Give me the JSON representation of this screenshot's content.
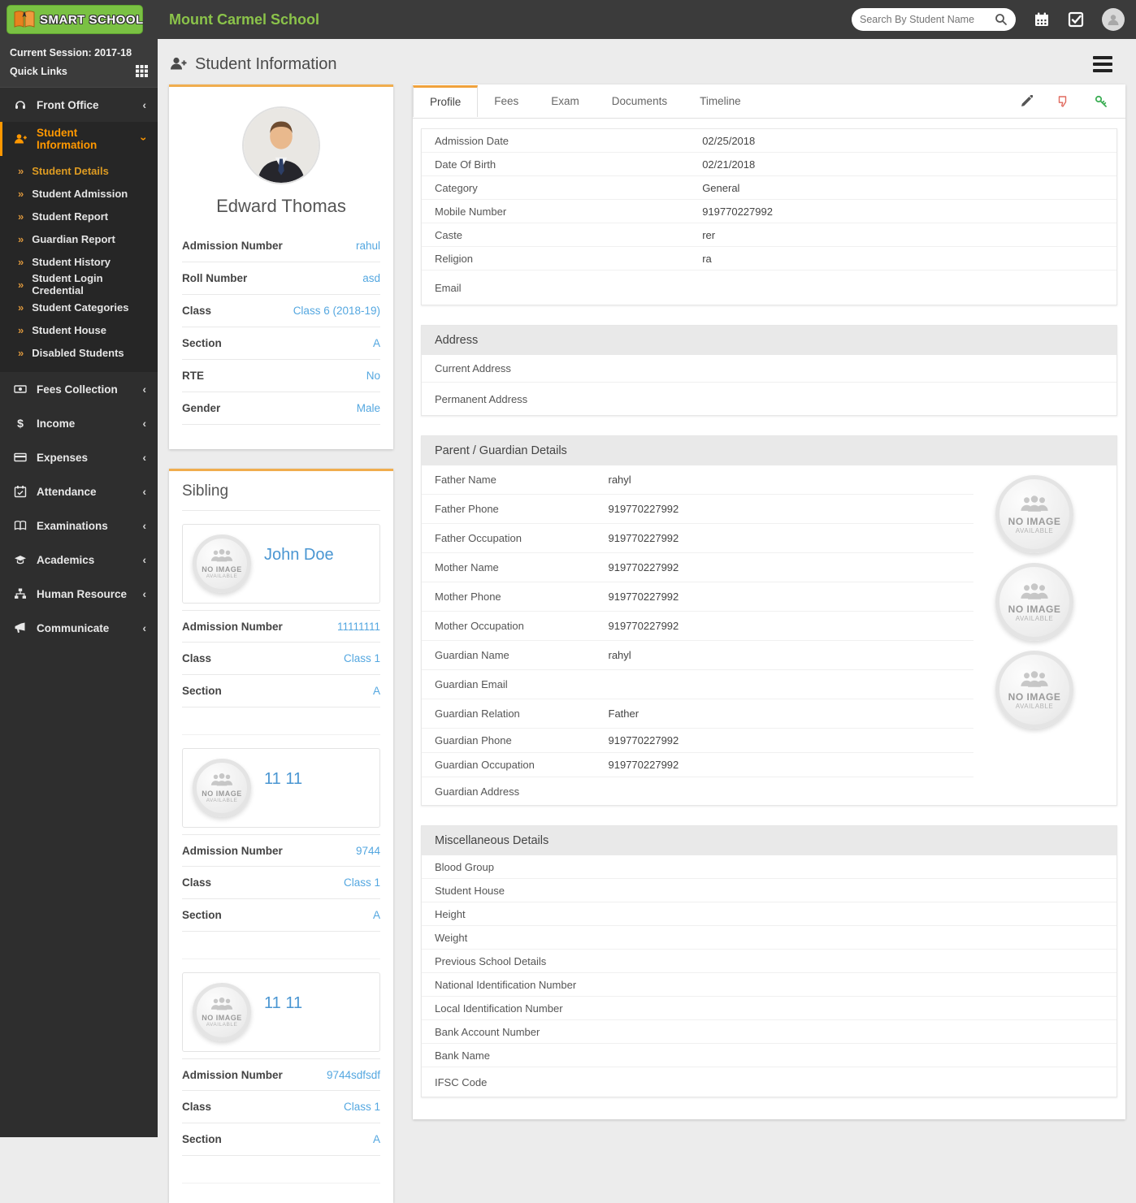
{
  "colors": {
    "accent_orange": "#ff9800",
    "brand_green": "#7ac143",
    "link_blue": "#54a7e0",
    "navbar_dark": "#3b3b3b",
    "sidebar_dark": "#2e2e2e"
  },
  "brand": {
    "logo_text": "SMART SCHOOL",
    "school_name": "Mount Carmel School"
  },
  "topbar": {
    "search_placeholder": "Search By Student Name"
  },
  "sidebar": {
    "session": "Current Session: 2017-18",
    "quick_links": "Quick Links",
    "front_office": "Front Office",
    "student_information": "Student Information",
    "submenu": [
      "Student Details",
      "Student Admission",
      "Student Report",
      "Guardian Report",
      "Student History",
      "Student Login Credential",
      "Student Categories",
      "Student House",
      "Disabled Students"
    ],
    "menu": [
      "Fees Collection",
      "Income",
      "Expenses",
      "Attendance",
      "Examinations",
      "Academics",
      "Human Resource",
      "Communicate"
    ]
  },
  "page": {
    "title": "Student Information"
  },
  "student_card": {
    "name": "Edward Thomas",
    "rows": [
      {
        "label": "Admission Number",
        "value": "rahul"
      },
      {
        "label": "Roll Number",
        "value": "asd"
      },
      {
        "label": "Class",
        "value": "Class 6 (2018-19)"
      },
      {
        "label": "Section",
        "value": "A"
      },
      {
        "label": "RTE",
        "value": "No"
      },
      {
        "label": "Gender",
        "value": "Male"
      }
    ]
  },
  "no_image": {
    "line1": "NO IMAGE",
    "line2": "AVAILABLE"
  },
  "sibling": {
    "title": "Sibling",
    "cards": [
      {
        "name": "John Doe",
        "rows": [
          {
            "label": "Admission Number",
            "value": "11111111"
          },
          {
            "label": "Class",
            "value": "Class 1"
          },
          {
            "label": "Section",
            "value": "A"
          }
        ]
      },
      {
        "name": "11 11",
        "rows": [
          {
            "label": "Admission Number",
            "value": "9744"
          },
          {
            "label": "Class",
            "value": "Class 1"
          },
          {
            "label": "Section",
            "value": "A"
          }
        ]
      },
      {
        "name": "11 11",
        "rows": [
          {
            "label": "Admission Number",
            "value": "9744sdfsdf"
          },
          {
            "label": "Class",
            "value": "Class 1"
          },
          {
            "label": "Section",
            "value": "A"
          }
        ]
      }
    ]
  },
  "tabs": [
    "Profile",
    "Fees",
    "Exam",
    "Documents",
    "Timeline"
  ],
  "profile": {
    "basic_rows": [
      {
        "label": "Admission Date",
        "value": "02/25/2018"
      },
      {
        "label": "Date Of Birth",
        "value": "02/21/2018"
      },
      {
        "label": "Category",
        "value": "General"
      },
      {
        "label": "Mobile Number",
        "value": "919770227992"
      },
      {
        "label": "Caste",
        "value": "rer"
      },
      {
        "label": "Religion",
        "value": "ra"
      },
      {
        "label": "Email",
        "value": ""
      }
    ],
    "address": {
      "title": "Address",
      "rows": [
        {
          "label": "Current Address",
          "value": ""
        },
        {
          "label": "Permanent Address",
          "value": ""
        }
      ]
    },
    "guardian": {
      "title": "Parent / Guardian Details",
      "rows": [
        {
          "label": "Father Name",
          "value": "rahyl"
        },
        {
          "label": "Father Phone",
          "value": "919770227992"
        },
        {
          "label": "Father Occupation",
          "value": "919770227992"
        },
        {
          "label": "Mother Name",
          "value": "919770227992"
        },
        {
          "label": "Mother Phone",
          "value": "919770227992"
        },
        {
          "label": "Mother Occupation",
          "value": "919770227992"
        },
        {
          "label": "Guardian Name",
          "value": "rahyl"
        },
        {
          "label": "Guardian Email",
          "value": ""
        },
        {
          "label": "Guardian Relation",
          "value": "Father"
        },
        {
          "label": "Guardian Phone",
          "value": "919770227992"
        },
        {
          "label": "Guardian Occupation",
          "value": "919770227992"
        },
        {
          "label": "Guardian Address",
          "value": ""
        }
      ]
    },
    "misc": {
      "title": "Miscellaneous Details",
      "rows": [
        {
          "label": "Blood Group",
          "value": ""
        },
        {
          "label": "Student House",
          "value": ""
        },
        {
          "label": "Height",
          "value": ""
        },
        {
          "label": "Weight",
          "value": ""
        },
        {
          "label": "Previous School Details",
          "value": ""
        },
        {
          "label": "National Identification Number",
          "value": ""
        },
        {
          "label": "Local Identification Number",
          "value": ""
        },
        {
          "label": "Bank Account Number",
          "value": ""
        },
        {
          "label": "Bank Name",
          "value": ""
        },
        {
          "label": "IFSC Code",
          "value": ""
        }
      ]
    }
  }
}
